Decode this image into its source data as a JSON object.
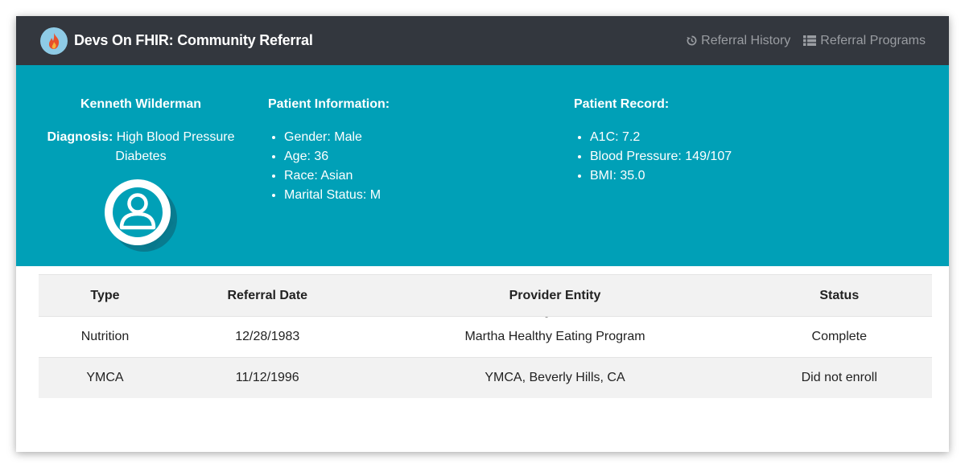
{
  "navbar": {
    "brand_title": "Devs On FHIR: Community Referral",
    "links": [
      {
        "label": "Referral History",
        "icon": "history-icon"
      },
      {
        "label": "Referral Programs",
        "icon": "list-icon"
      }
    ]
  },
  "patient": {
    "name": "Kenneth Wilderman",
    "diagnosis_label": "Diagnosis:",
    "diagnosis_line1": "High Blood Pressure",
    "diagnosis_line2": "Diabetes",
    "info_heading": "Patient Information:",
    "info": [
      "Gender: Male",
      "Age: 36",
      "Race: Asian",
      "Marital Status: M"
    ],
    "record_heading": "Patient Record:",
    "record": [
      "A1C: 7.2",
      "Blood Pressure: 149/107",
      "BMI: 35.0"
    ]
  },
  "history": {
    "title": "Referral History",
    "columns": [
      "Type",
      "Referral Date",
      "Provider Entity",
      "Status"
    ],
    "rows": [
      [
        "Nutrition",
        "12/28/1983",
        "Martha Healthy Eating Program",
        "Complete"
      ],
      [
        "YMCA",
        "11/12/1996",
        "YMCA, Beverly Hills, CA",
        "Did not enroll"
      ]
    ]
  },
  "colors": {
    "navbar": "#33373e",
    "banner": "#00a0b7",
    "nav_link": "#9a9da2",
    "logo_bg": "#8ecbe6",
    "flame": "#e8502a"
  }
}
